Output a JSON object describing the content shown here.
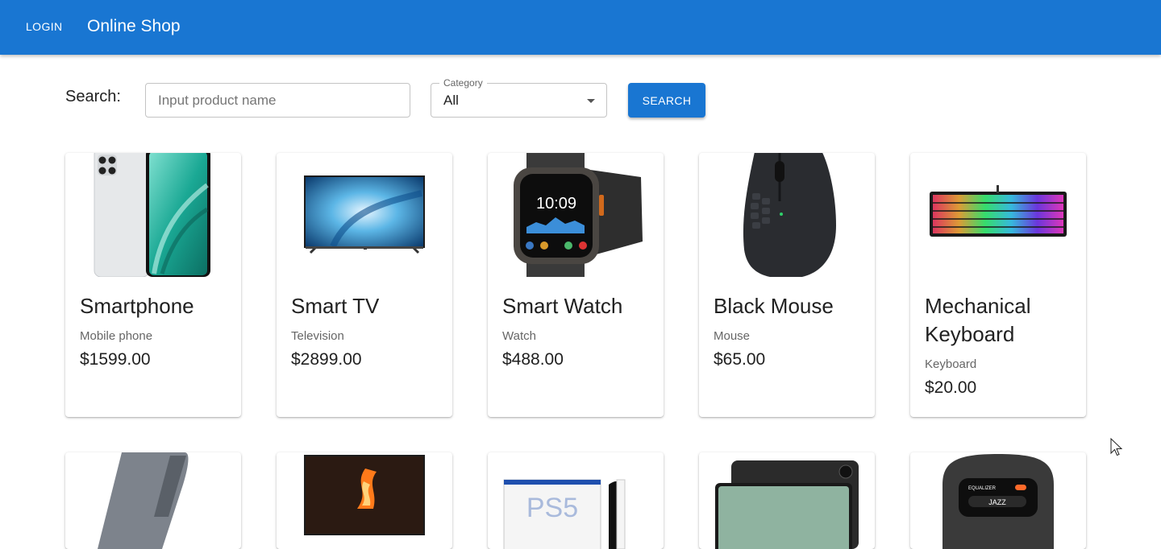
{
  "header": {
    "login_label": "LOGIN",
    "title": "Online Shop",
    "color": "#1976d2"
  },
  "search": {
    "label": "Search:",
    "placeholder": "Input product name",
    "value": "",
    "category_label": "Category",
    "category_value": "All",
    "button_label": "SEARCH"
  },
  "products": [
    {
      "name": "Smartphone",
      "category": "Mobile phone",
      "price": "$1599.00",
      "icon": "smartphone-image"
    },
    {
      "name": "Smart TV",
      "category": "Television",
      "price": "$2899.00",
      "icon": "tv-image"
    },
    {
      "name": "Smart Watch",
      "category": "Watch",
      "price": "$488.00",
      "icon": "watch-image"
    },
    {
      "name": "Black Mouse",
      "category": "Mouse",
      "price": "$65.00",
      "icon": "mouse-image"
    },
    {
      "name": "Mechanical Keyboard",
      "category": "Keyboard",
      "price": "$20.00",
      "icon": "keyboard-image"
    },
    {
      "icon": "power-bank-image"
    },
    {
      "icon": "monitor-image"
    },
    {
      "icon": "game-console-image"
    },
    {
      "icon": "tablet-image"
    },
    {
      "icon": "speaker-image"
    }
  ],
  "product_images": {
    "watch_time": "10:09",
    "speaker_screen_title": "EQUALIZER",
    "speaker_screen_mode": "JAZZ"
  }
}
